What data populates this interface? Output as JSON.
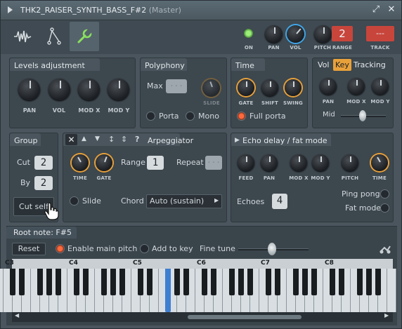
{
  "window": {
    "title": "THK2_RAISER_SYNTH_BASS_F#2",
    "subtitle": "(Master)",
    "pin_glyph": "⤢",
    "close_glyph": "✕"
  },
  "header": {
    "on_label": "ON",
    "pan_label": "PAN",
    "vol_label": "VOL",
    "pitch_label": "PITCH",
    "range_label": "RANGE",
    "range_value": "2",
    "track_label": "TRACK",
    "track_value": "---"
  },
  "levels": {
    "title": "Levels adjustment",
    "knobs": [
      "PAN",
      "VOL",
      "MOD X",
      "MOD Y"
    ]
  },
  "polyphony": {
    "title": "Polyphony",
    "max_label": "Max",
    "slide_label": "SLIDE",
    "porta_label": "Porta",
    "mono_label": "Mono"
  },
  "time": {
    "title": "Time",
    "knobs": [
      "GATE",
      "SHIFT",
      "SWING"
    ],
    "full_porta_label": "Full porta"
  },
  "vkt": {
    "tabs": [
      "Vol",
      "Key",
      "Tracking"
    ],
    "active_tab": "Key",
    "knobs": [
      "PAN",
      "MOD X",
      "MOD Y"
    ],
    "mid_label": "Mid"
  },
  "group": {
    "title": "Group",
    "cut_label": "Cut",
    "cut_value": "2",
    "by_label": "By",
    "by_value": "2",
    "cut_self_label": "Cut self"
  },
  "arp": {
    "title": "Arpeggiator",
    "help_glyph": "?",
    "time_label": "TIME",
    "gate_label": "GATE",
    "range_label": "Range",
    "range_value": "1",
    "repeat_label": "Repeat",
    "slide_label": "Slide",
    "chord_label": "Chord",
    "chord_value": "Auto (sustain)"
  },
  "echo": {
    "title": "Echo delay / fat mode",
    "knobs": [
      "FEED",
      "PAN",
      "MOD X",
      "MOD Y",
      "PITCH",
      "TIME"
    ],
    "echoes_label": "Echoes",
    "echoes_value": "4",
    "ping_pong_label": "Ping pong",
    "fat_mode_label": "Fat mode"
  },
  "root": {
    "title": "Root note: F#5",
    "reset_label": "Reset",
    "enable_main_pitch_label": "Enable main pitch",
    "add_to_key_label": "Add to key",
    "fine_tune_label": "Fine tune"
  },
  "keyboard": {
    "octaves": [
      "C3",
      "C4",
      "C5",
      "C6",
      "C7",
      "C8"
    ],
    "highlight_note": "F#5"
  },
  "colors": {
    "accent_orange": "#e8a13a",
    "accent_blue": "#3fa6e8",
    "led_green": "#7bdc5a",
    "range_red": "#c8453c"
  }
}
